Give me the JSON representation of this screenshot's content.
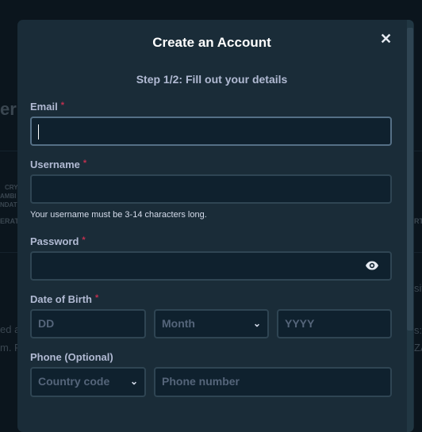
{
  "background": {
    "fragments": [
      "er",
      "CRY",
      "AMBI",
      "NDAT",
      "ERAT",
      "ed a",
      "m. F",
      "sit",
      "s:",
      "ZA",
      "RT"
    ]
  },
  "modal": {
    "title": "Create an Account",
    "close_icon": "close-icon",
    "step": "Step 1/2: Fill out your details",
    "email": {
      "label": "Email",
      "required": "*",
      "value": ""
    },
    "username": {
      "label": "Username",
      "required": "*",
      "value": "",
      "help": "Your username must be 3-14 characters long."
    },
    "password": {
      "label": "Password",
      "required": "*",
      "value": "",
      "toggle_icon": "eye-icon"
    },
    "dob": {
      "label": "Date of Birth",
      "required": "*",
      "day_placeholder": "DD",
      "month_placeholder": "Month",
      "year_placeholder": "YYYY"
    },
    "phone": {
      "label": "Phone (Optional)",
      "country_placeholder": "Country code",
      "number_placeholder": "Phone number"
    }
  },
  "colors": {
    "modal_bg": "#1a2c38",
    "input_bg": "#0f212e",
    "border": "#2f4553",
    "required": "#c0304f"
  }
}
